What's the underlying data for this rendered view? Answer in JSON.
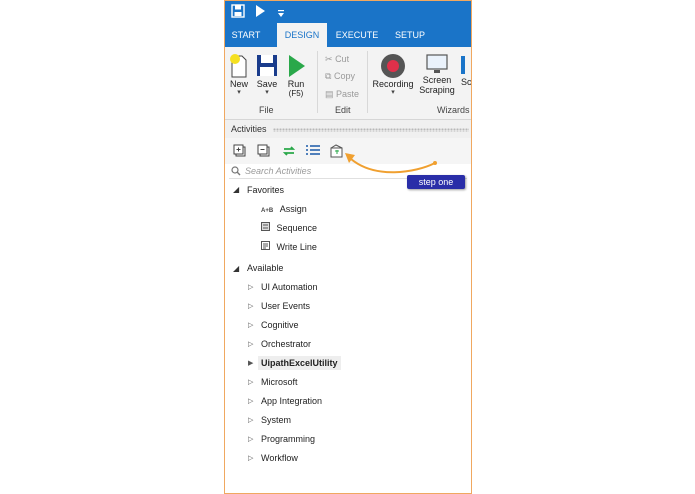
{
  "tabs": [
    {
      "label": "START"
    },
    {
      "label": "DESIGN"
    },
    {
      "label": "EXECUTE"
    },
    {
      "label": "SETUP"
    }
  ],
  "ribbon": {
    "new_label": "New",
    "save_label": "Save",
    "run_label": "Run",
    "run_shortcut": "(F5)",
    "file_group": "File",
    "cut_label": "Cut",
    "copy_label": "Copy",
    "paste_label": "Paste",
    "edit_group": "Edit",
    "recording_label": "Recording",
    "screen_scraping_line1": "Screen",
    "screen_scraping_line2": "Scraping",
    "cut_partial": "Sc",
    "wizards_group": "Wizards",
    "colors": {
      "accent": "#1a74c8",
      "record": "#e0304a",
      "run": "#2aa84a"
    }
  },
  "panel": {
    "title": "Activities",
    "search_placeholder": "Search Activities",
    "favorites": {
      "label": "Favorites",
      "items": [
        {
          "label": "Assign",
          "icon": "assign-icon"
        },
        {
          "label": "Sequence",
          "icon": "sequence-icon"
        },
        {
          "label": "Write Line",
          "icon": "write-line-icon"
        }
      ]
    },
    "available": {
      "label": "Available",
      "items": [
        {
          "label": "UI Automation"
        },
        {
          "label": "User Events"
        },
        {
          "label": "Cognitive"
        },
        {
          "label": "Orchestrator"
        },
        {
          "label": "UipathExcelUtility",
          "selected": true
        },
        {
          "label": "Microsoft"
        },
        {
          "label": "App Integration"
        },
        {
          "label": "System"
        },
        {
          "label": "Programming"
        },
        {
          "label": "Workflow"
        }
      ]
    }
  },
  "annotation": {
    "label": "step one",
    "color": "#2a2ea8",
    "arrow_color": "#f0a030"
  }
}
